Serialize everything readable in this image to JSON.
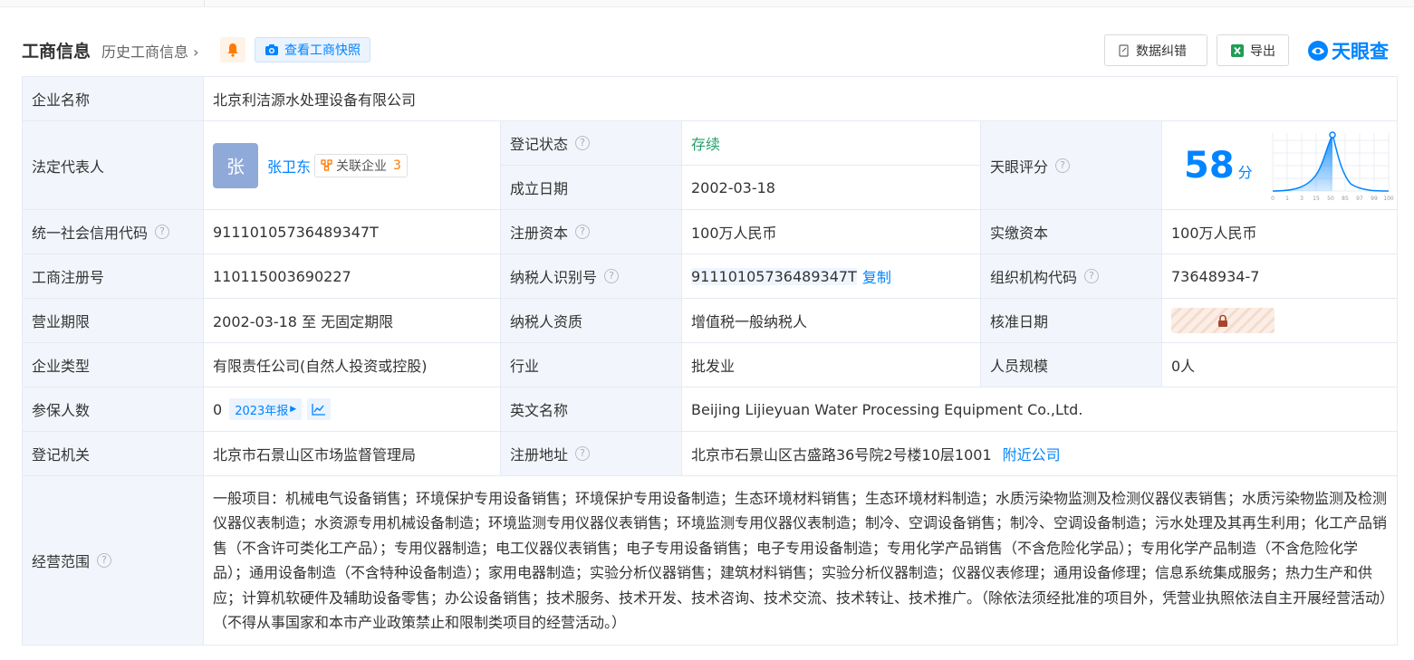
{
  "header": {
    "title": "工商信息",
    "history_link": "历史工商信息",
    "snapshot_label": "查看工商快照",
    "correct_label": "数据纠错",
    "export_label": "导出",
    "brand": "天眼查"
  },
  "rows": {
    "company_name": {
      "label": "企业名称",
      "value": "北京利洁源水处理设备有限公司"
    },
    "legal_rep": {
      "label": "法定代表人",
      "avatar": "张",
      "name": "张卫东",
      "related_label": "关联企业",
      "related_count": "3"
    },
    "reg_status": {
      "label": "登记状态",
      "value": "存续"
    },
    "found_date": {
      "label": "成立日期",
      "value": "2002-03-18"
    },
    "score": {
      "label": "天眼评分",
      "value": "58",
      "unit": "分",
      "axis_ticks": [
        "0",
        "1",
        "3",
        "15",
        "50",
        "85",
        "97",
        "99",
        "100"
      ]
    },
    "credit_code": {
      "label": "统一社会信用代码",
      "value": "91110105736489347T"
    },
    "reg_capital": {
      "label": "注册资本",
      "value": "100万人民币"
    },
    "paid_capital": {
      "label": "实缴资本",
      "value": "100万人民币"
    },
    "reg_number": {
      "label": "工商注册号",
      "value": "110115003690227"
    },
    "taxpayer_id": {
      "label": "纳税人识别号",
      "value": "91110105736489347T",
      "copy_label": "复制"
    },
    "org_code": {
      "label": "组织机构代码",
      "value": "73648934-7"
    },
    "term": {
      "label": "营业期限",
      "value": "2002-03-18 至 无固定期限"
    },
    "tax_qual": {
      "label": "纳税人资质",
      "value": "增值税一般纳税人"
    },
    "approve_date": {
      "label": "核准日期"
    },
    "company_type": {
      "label": "企业类型",
      "value": "有限责任公司(自然人投资或控股)"
    },
    "industry": {
      "label": "行业",
      "value": "批发业"
    },
    "staff_size": {
      "label": "人员规模",
      "value": "0人"
    },
    "insured": {
      "label": "参保人数",
      "value": "0",
      "report_label": "2023年报"
    },
    "english_name": {
      "label": "英文名称",
      "value": "Beijing Lijieyuan Water Processing Equipment Co.,Ltd."
    },
    "reg_authority": {
      "label": "登记机关",
      "value": "北京市石景山区市场监督管理局"
    },
    "reg_address": {
      "label": "注册地址",
      "value": "北京市石景山区古盛路36号院2号楼10层1001",
      "nearby_label": "附近公司"
    },
    "scope": {
      "label": "经营范围",
      "value": "一般项目：机械电气设备销售；环境保护专用设备销售；环境保护专用设备制造；生态环境材料销售；生态环境材料制造；水质污染物监测及检测仪器仪表销售；水质污染物监测及检测仪器仪表制造；水资源专用机械设备制造；环境监测专用仪器仪表销售；环境监测专用仪器仪表制造；制冷、空调设备销售；制冷、空调设备制造；污水处理及其再生利用；化工产品销售（不含许可类化工产品）；专用仪器制造；电工仪器仪表销售；电子专用设备销售；电子专用设备制造；专用化学产品销售（不含危险化学品）；专用化学产品制造（不含危险化学品）；通用设备制造（不含特种设备制造）；家用电器制造；实验分析仪器销售；建筑材料销售；实验分析仪器制造；仪器仪表修理；通用设备修理；信息系统集成服务；热力生产和供应；计算机软硬件及辅助设备零售；办公设备销售；技术服务、技术开发、技术咨询、技术交流、技术转让、技术推广。（除依法须经批准的项目外，凭营业执照依法自主开展经营活动）（不得从事国家和本市产业政策禁止和限制类项目的经营活动。）"
    }
  },
  "colors": {
    "accent": "#0084ff",
    "label_bg": "#f2f6fc",
    "status_green": "#22a06b",
    "border": "#e5eaf3"
  }
}
